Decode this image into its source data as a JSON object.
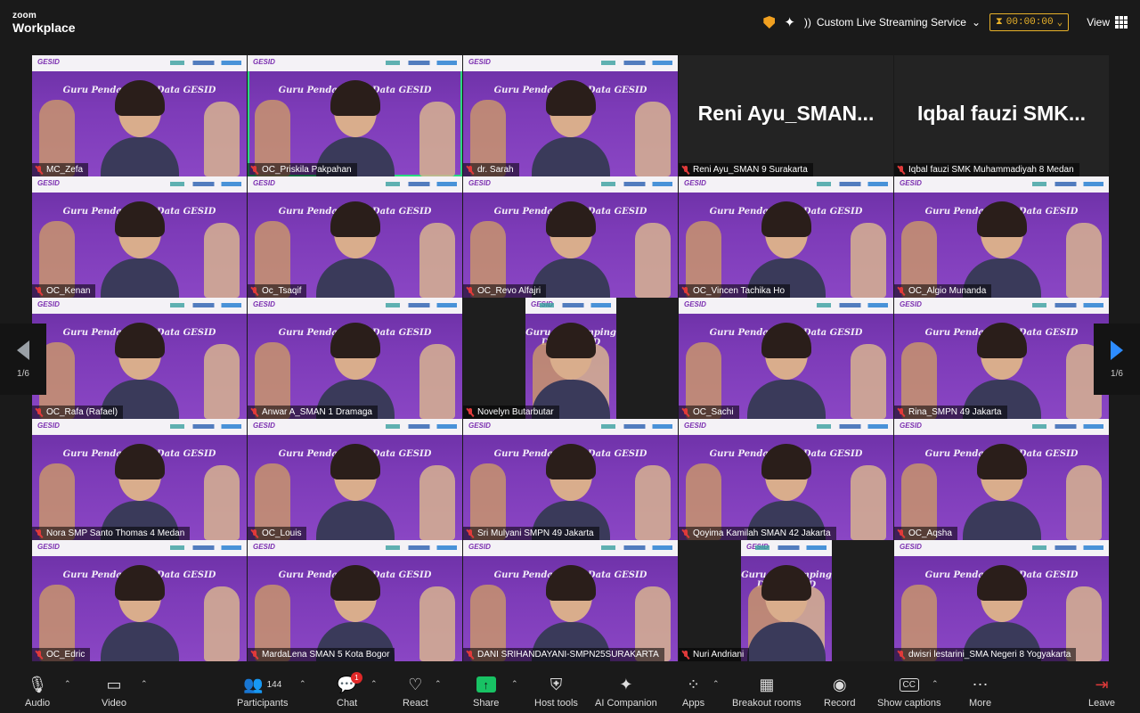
{
  "app": {
    "brand_top": "zoom",
    "brand_name": "Workplace"
  },
  "topbar": {
    "shield_icon": "shield-icon",
    "ai_icon": "sparkle-icon",
    "streaming_label": "Custom Live Streaming Service",
    "timer": "00:00:00",
    "view_label": "View"
  },
  "tile_content": {
    "logo": "GESID",
    "banner": "Guru Pendamping Data GESID"
  },
  "gallery": {
    "page_left": "1/6",
    "page_right": "1/6",
    "tiles": [
      {
        "name": "MC_Zefa",
        "type": "video"
      },
      {
        "name": "OC_Priskila Pakpahan",
        "type": "video",
        "active": true
      },
      {
        "name": "dr. Sarah",
        "type": "video"
      },
      {
        "name": "Reni Ayu_SMAN 9 Surakarta",
        "type": "blank",
        "display": "Reni  Ayu_SMAN..."
      },
      {
        "name": "Iqbal fauzi SMK Muhammadiyah 8 Medan",
        "type": "blank",
        "display": "Iqbal  fauzi  SMK..."
      },
      {
        "name": "OC_Kenan",
        "type": "video"
      },
      {
        "name": "Oc_Tsaqif",
        "type": "video"
      },
      {
        "name": "OC_Revo Alfajri",
        "type": "video"
      },
      {
        "name": "OC_Vincen Tachika Ho",
        "type": "video"
      },
      {
        "name": "OC_Algio Munanda",
        "type": "video"
      },
      {
        "name": "OC_Rafa (Rafael)",
        "type": "video"
      },
      {
        "name": "Anwar A_SMAN 1 Dramaga",
        "type": "video"
      },
      {
        "name": "Novelyn Butarbutar",
        "type": "narrow"
      },
      {
        "name": "OC_Sachi",
        "type": "video"
      },
      {
        "name": "Rina_SMPN 49 Jakarta",
        "type": "video"
      },
      {
        "name": "Nora SMP Santo Thomas 4 Medan",
        "type": "video"
      },
      {
        "name": "OC_Louis",
        "type": "video"
      },
      {
        "name": "Sri Mulyani SMPN 49 Jakarta",
        "type": "video"
      },
      {
        "name": "Qoyima Kamilah SMAN 42 Jakarta",
        "type": "video"
      },
      {
        "name": "OC_Aqsha",
        "type": "video"
      },
      {
        "name": "OC_Edric",
        "type": "video"
      },
      {
        "name": "MardaLena SMAN 5 Kota Bogor",
        "type": "video"
      },
      {
        "name": "DANI SRIHANDAYANI-SMPN25SURAKARTA",
        "type": "video"
      },
      {
        "name": "Nuri Andriani",
        "type": "narrow"
      },
      {
        "name": "dwisri lestarini_SMA Negeri 8 Yogyakarta",
        "type": "video"
      }
    ]
  },
  "toolbar": {
    "audio": "Audio",
    "video": "Video",
    "participants": "Participants",
    "participants_count": "144",
    "chat": "Chat",
    "chat_badge": "1",
    "react": "React",
    "share": "Share",
    "host_tools": "Host tools",
    "ai_companion": "AI Companion",
    "apps": "Apps",
    "breakout": "Breakout rooms",
    "record": "Record",
    "captions": "Show captions",
    "captions_icon_text": "CC",
    "more": "More",
    "leave": "Leave"
  }
}
